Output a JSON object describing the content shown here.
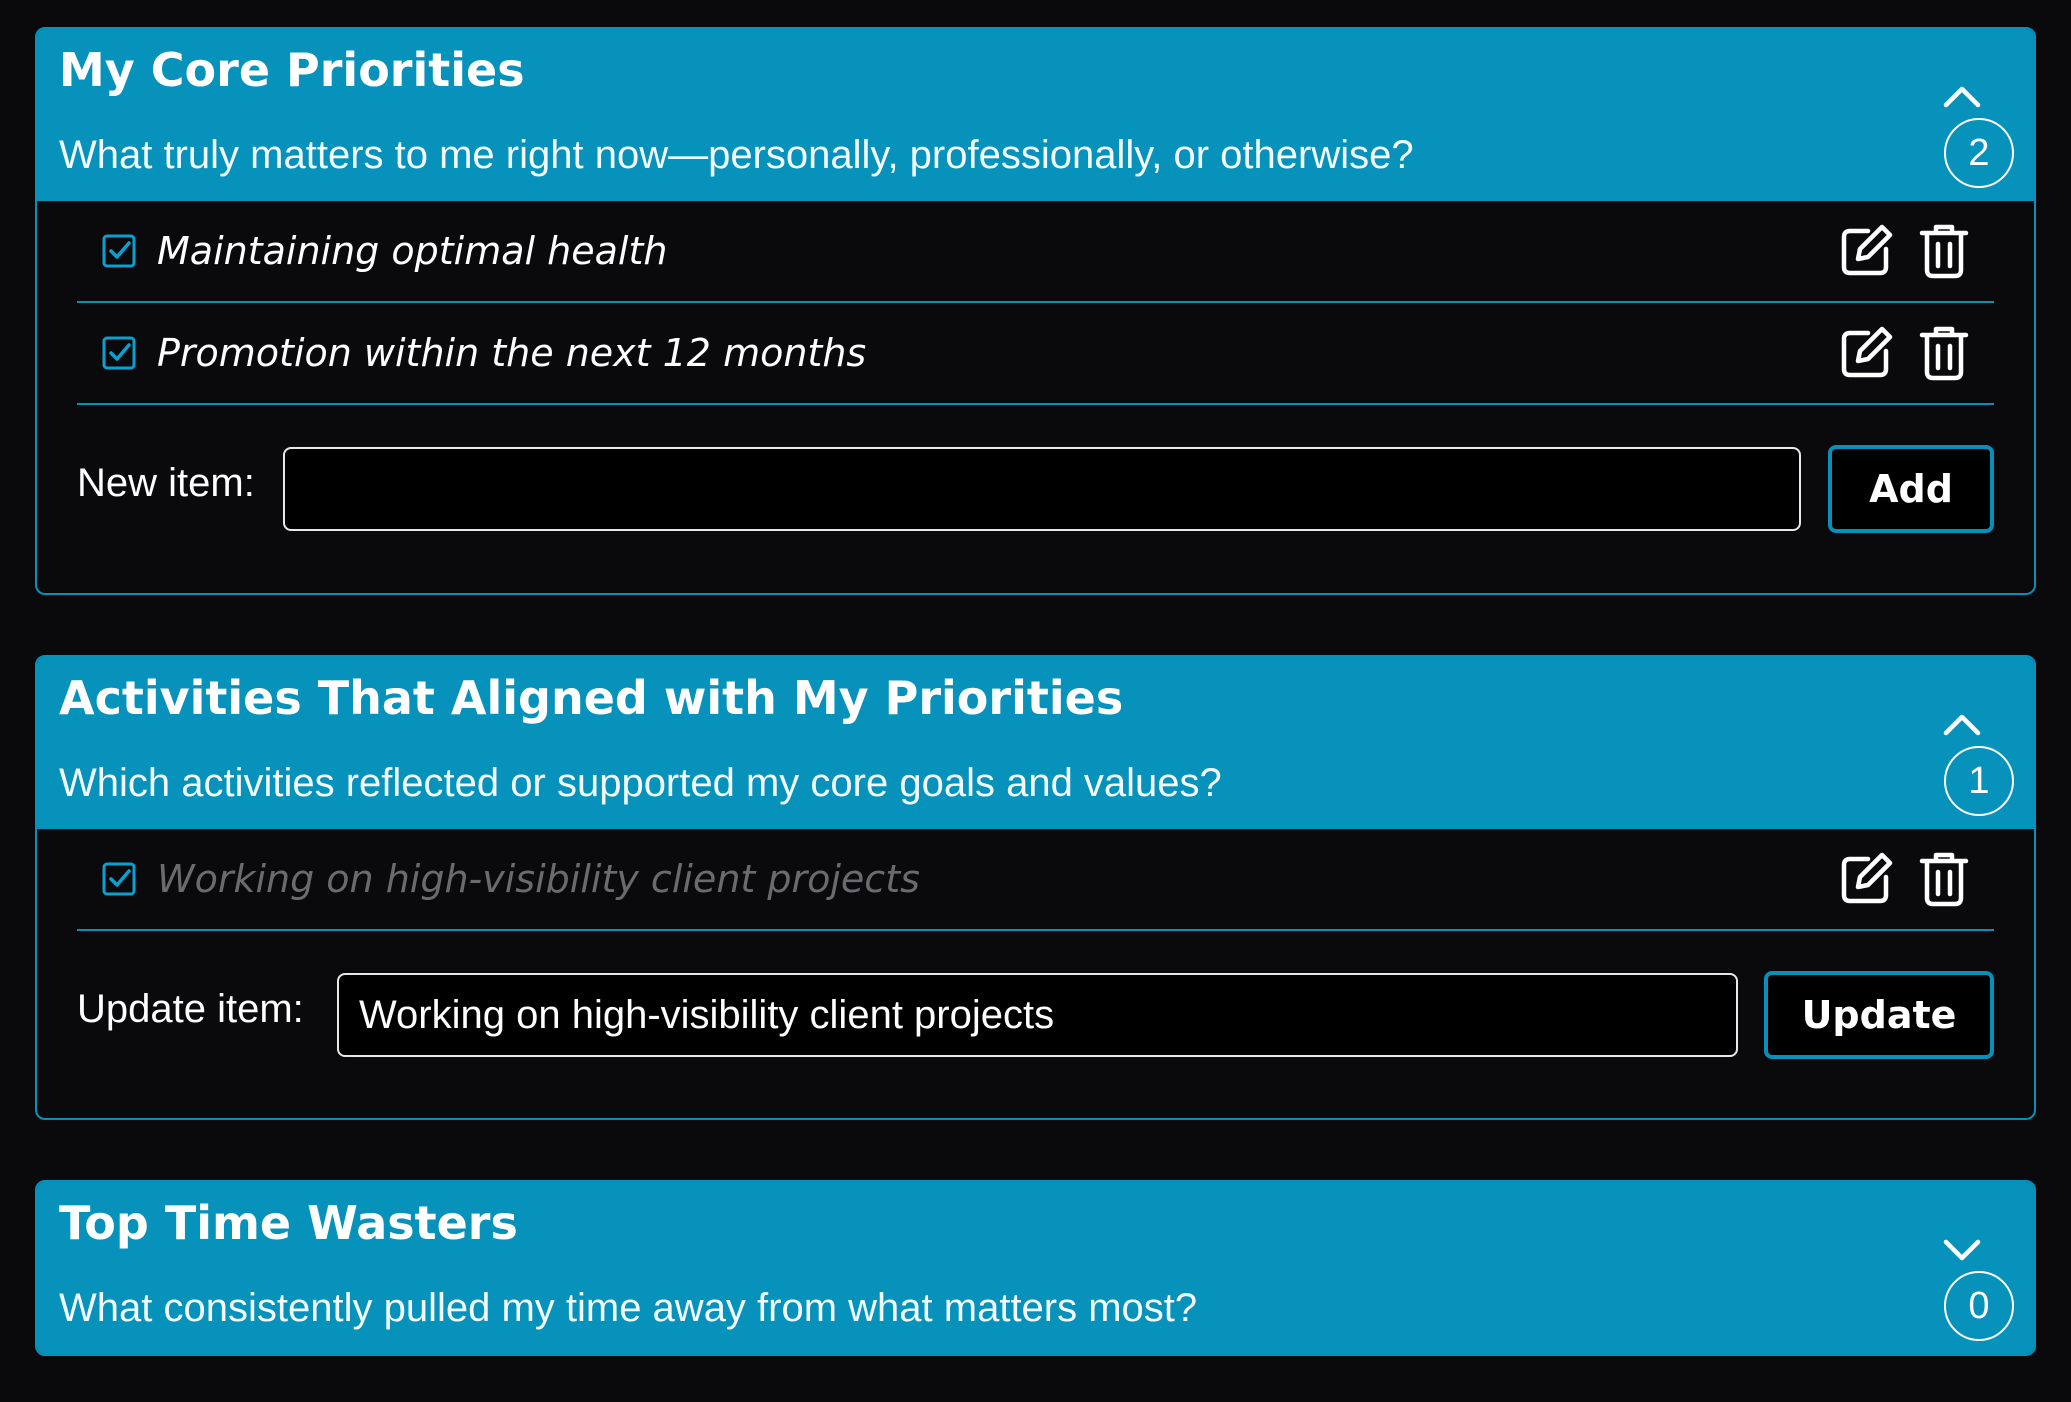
{
  "sections": [
    {
      "title": "My Core Priorities",
      "subtitle": "What truly matters to me right now—personally, professionally, or otherwise?",
      "count": "2",
      "chevron": "chevron-up-icon",
      "items": [
        {
          "text": "Maintaining optimal health"
        },
        {
          "text": "Promotion within the next 12 months"
        }
      ],
      "form": {
        "label": "New item:",
        "value": "",
        "button": "Add"
      }
    },
    {
      "title": "Activities That Aligned with My Priorities",
      "subtitle": "Which activities reflected or supported my core goals and values?",
      "count": "1",
      "chevron": "chevron-up-icon",
      "items": [
        {
          "text": "Working on high-visibility client projects",
          "state": "editing"
        }
      ],
      "form": {
        "label": "Update item:",
        "value": "Working on high-visibility client projects",
        "button": "Update"
      }
    },
    {
      "title": "Top Time Wasters",
      "subtitle": "What consistently pulled my time away from what matters most?",
      "count": "0",
      "chevron": "chevron-down-icon"
    }
  ],
  "colors": {
    "accent": "#0792bc",
    "background": "#0a0a0d",
    "dimmed_text": "#6b6b6e"
  }
}
